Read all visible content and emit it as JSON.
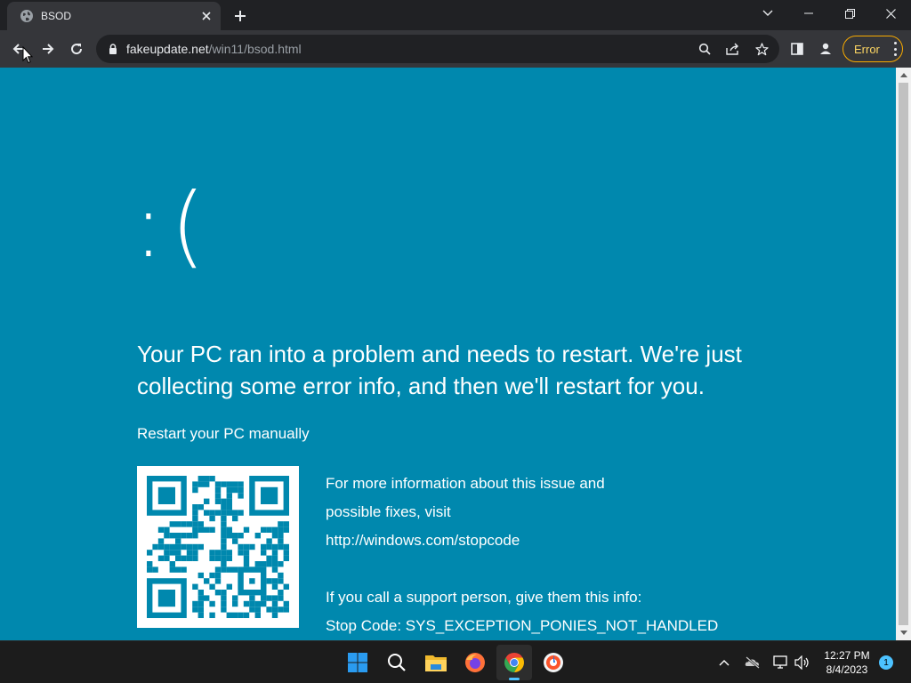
{
  "browser": {
    "tab": {
      "title": "BSOD"
    },
    "address": {
      "host": "fakeupdate.net",
      "path": "/win11/bsod.html"
    },
    "profile_chip": {
      "label": "Error"
    }
  },
  "bsod": {
    "frown": ":(",
    "headline": "Your PC ran into a problem and needs to restart. We're just collecting some error info, and then we'll restart for you.",
    "restart_manually": "Restart your PC manually",
    "info_line1": "For more information about this issue and",
    "info_line2": "possible fixes, visit",
    "info_url": "http://windows.com/stopcode",
    "support_line": "If you call a support person, give them this info:",
    "stop_code": "Stop Code: SYS_EXCEPTION_PONIES_NOT_HANDLED",
    "background_color": "#0088ae"
  },
  "taskbar": {
    "apps": [
      "start-icon",
      "search-icon",
      "file-explorer-icon",
      "firefox-icon",
      "chrome-icon",
      "brave-icon"
    ],
    "active_app": "chrome-icon",
    "clock": {
      "time": "12:27 PM",
      "date": "8/4/2023"
    },
    "notification_count": "1"
  }
}
